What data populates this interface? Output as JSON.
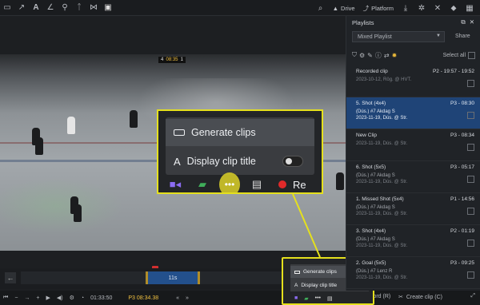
{
  "topbar": {
    "drive_label": "Drive",
    "platform_label": "Platform"
  },
  "scorebug": {
    "left": "4",
    "clock": "08:35",
    "right": "1"
  },
  "popup": {
    "generate_clips": "Generate clips",
    "display_clip_title": "Display clip title",
    "display_clip_title_on": false,
    "record_label": "Re"
  },
  "timeline": {
    "clip_label": "11s"
  },
  "bottombar": {
    "time": "01:33:50",
    "period": "P3",
    "game_time": "08:34.38",
    "record_label": "Record (R)",
    "create_clip_label": "Create clip (C)"
  },
  "small_popup": {
    "generate_clips": "Generate clips",
    "display_clip_title": "Display clip title"
  },
  "sidebar": {
    "title": "Playlists",
    "playlist_select": "Mixed Playlist",
    "share_label": "Share",
    "select_all_label": "Select all",
    "clips": [
      {
        "title": "Recorded clip",
        "time": "P2 - 19:57 - 19:52",
        "line1": "",
        "line2": "2023-10-12, Rög. @ HVT."
      },
      {
        "title": "5. Shot (4x4)",
        "time": "P3 - 08:30",
        "line1": "(Dús.) #7 Akdag S",
        "line2": "2023-11-19, Dús. @ Str."
      },
      {
        "title": "New Clip",
        "time": "P3 - 08:34",
        "line1": "",
        "line2": "2023-11-19, Dús. @ Str."
      },
      {
        "title": "6. Shot (5x5)",
        "time": "P3 - 05:17",
        "line1": "(Dús.) #7 Akdag S",
        "line2": "2023-11-19, Dús. @ Str."
      },
      {
        "title": "1. Missed Shot (5x4)",
        "time": "P1 - 14:56",
        "line1": "(Dús.) #7 Akdag S",
        "line2": "2023-11-19, Dús. @ Str."
      },
      {
        "title": "3. Shot (4x4)",
        "time": "P2 - 01:19",
        "line1": "(Dús.) #7 Akdag S",
        "line2": "2023-11-19, Dús. @ Str."
      },
      {
        "title": "2. Goal (5x5)",
        "time": "P3 - 09:25",
        "line1": "(Dús.) #7 Lenz R",
        "line2": "2023-11-19, Dús. @ Str."
      }
    ]
  },
  "colors": {
    "accent_yellow": "#e5e01d",
    "selected_blue": "#1f4477",
    "record_red": "#e02a2a"
  }
}
